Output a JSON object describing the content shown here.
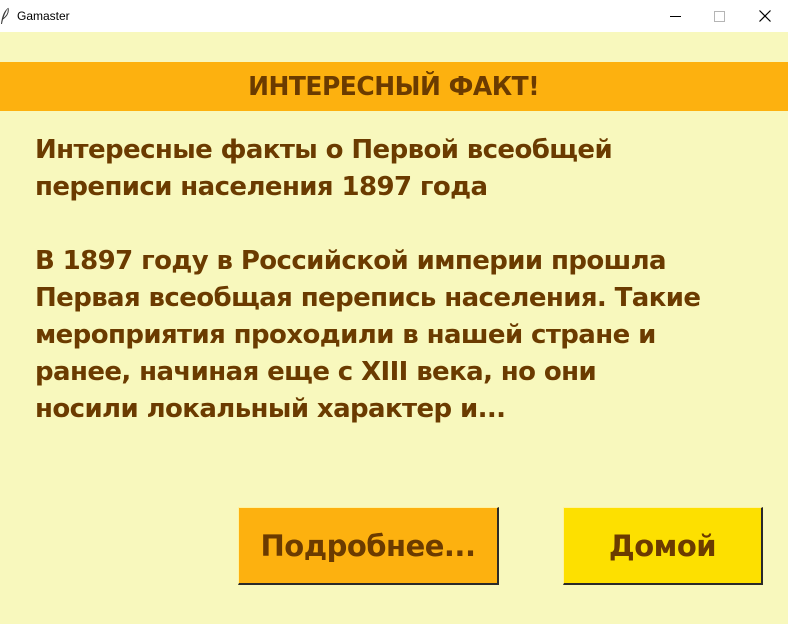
{
  "window": {
    "title": "Gamaster",
    "icon": "feather-icon",
    "controls": {
      "minimize_icon": "minimize-icon",
      "maximize_icon": "maximize-icon",
      "close_icon": "close-icon"
    }
  },
  "header": {
    "text": "ИНТЕРЕСНЫЙ ФАКТ!"
  },
  "fact": {
    "title_lines": [
      "Интересные факты о Первой всеобщей",
      "переписи населения 1897 года"
    ],
    "text_lines": [
      "В 1897 году в Российской империи прошла",
      "Первая всеобщая перепись населения. Такие",
      "мероприятия проходили в нашей стране и",
      "ранее, начиная еще с XIII века, но они",
      "носили локальный характер и..."
    ]
  },
  "buttons": {
    "more_label": "Подробнее...",
    "home_label": "Домой"
  },
  "colors": {
    "background": "#f8f8bd",
    "header_band": "#fdb10f",
    "text": "#6b3b00",
    "more_button": "#fdb10f",
    "home_button": "#fde000"
  }
}
